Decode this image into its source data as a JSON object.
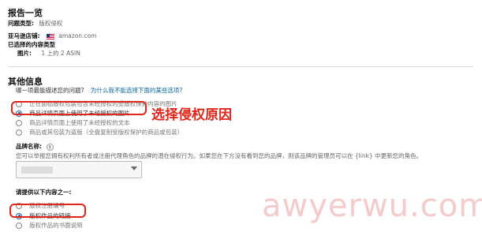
{
  "report": {
    "title": "报告一览",
    "issue_type_label": "问题类型:",
    "issue_type_value": "版权侵权",
    "store_label": "亚马逊店铺:",
    "store_value": "amazon.com",
    "selected_label": "已选择的内容类型",
    "images_label": "图片:",
    "images_value": "1 上的 2 ASIN"
  },
  "other": {
    "title": "其他信息",
    "question": "哪一项最能描述您的问题?",
    "why_link": "为什么我不能选择下面的某些选项?",
    "options": [
      {
        "label": "正在面临版权包装包含未经授权的受版权保护内容的图片",
        "selected": false,
        "dim": true
      },
      {
        "label": "商品详情页面上使用了未经授权的图片",
        "selected": true,
        "dim": false
      },
      {
        "label": "商品详情页面上使用了未经授权的文本",
        "selected": false,
        "dim": true
      },
      {
        "label": "商品或其包装为盗版（全盘复制受版权保护的商品或包装）",
        "selected": false,
        "dim": true
      }
    ],
    "annotation": "选择侵权原因"
  },
  "brand": {
    "label": "品牌名称:",
    "help": "?",
    "description": "您可以举报您拥有权利所有者或注册代理角色的品牌的潜在侵权行为。如果您在下方没有看到您的品牌，则该品牌的管理员可以在 {link} 中更新您的角色。",
    "select_value": ""
  },
  "provide": {
    "title": "请提供以下内容之一:",
    "options": [
      {
        "label": "版权注册编号",
        "selected": false
      },
      {
        "label": "版权作品的链接",
        "selected": true
      },
      {
        "label": "版权作品的书面说明",
        "selected": false
      }
    ]
  },
  "watermark": "awyerwu.com",
  "colors": {
    "accent_red": "#e1251b",
    "link_blue": "#0b6aa8",
    "radio_blue": "#1e62b5"
  }
}
